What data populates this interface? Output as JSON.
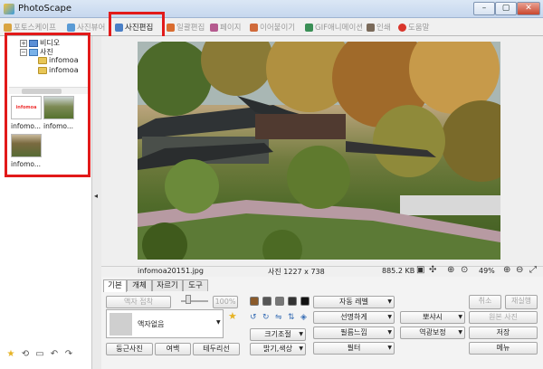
{
  "window": {
    "title": "PhotoScape",
    "min": "–",
    "max": "▢",
    "close": "✕"
  },
  "tabs": [
    {
      "label": "포토스케이프",
      "active": false,
      "color": "#d9a441"
    },
    {
      "label": "사진뷰어",
      "active": false,
      "color": "#5a9bd5"
    },
    {
      "label": "사진편집",
      "active": true,
      "color": "#4a7fc6"
    },
    {
      "label": "일괄편집",
      "active": false,
      "color": "#d96c2f"
    },
    {
      "label": "페이지",
      "active": false,
      "color": "#b55a8f"
    },
    {
      "label": "이어붙이기",
      "active": false,
      "color": "#d06a3a"
    },
    {
      "label": "GIF애니메이션",
      "active": false,
      "color": "#3a8f56"
    },
    {
      "label": "인쇄",
      "active": false,
      "color": "#7a6a5a"
    },
    {
      "label": "도움말",
      "active": false,
      "color": "#d9352b"
    }
  ],
  "tree": {
    "video": "비디오",
    "photo": "사진",
    "folder1": "infomoa",
    "folder2": "infomoa"
  },
  "thumbnails": [
    {
      "label": "infomo...",
      "watermark": "infomoa"
    },
    {
      "label": "infomo..."
    },
    {
      "label": "infomo..."
    }
  ],
  "status": {
    "filename": "infomoa20151.jpg",
    "dimensions": "사진 1227 x 738",
    "filesize": "885.2 KB",
    "zoom": "49%"
  },
  "edit_tabs": [
    "기본",
    "개체",
    "자르기",
    "도구"
  ],
  "edit": {
    "frame_apply": "액자 접착",
    "percent": "100%",
    "frame_none": "액자없음",
    "round": "둥근사진",
    "margin": "여백",
    "border": "테두리선",
    "resize": "크기조절",
    "brightness": "밝기,색상",
    "auto_level": "자동 레벨",
    "sharpen": "선명하게",
    "film": "필름느낌",
    "filter": "필터",
    "backlight": "뽀샤시",
    "backlight_fix": "역광보정",
    "cancel": "취소",
    "redo": "재실행",
    "original": "원본 사진",
    "save": "저장",
    "menu": "메뉴"
  },
  "colors": {
    "highlight": "#e21a1a",
    "swatches": [
      "#8a5a2a",
      "#555555",
      "#777777",
      "#333333",
      "#111111"
    ]
  }
}
